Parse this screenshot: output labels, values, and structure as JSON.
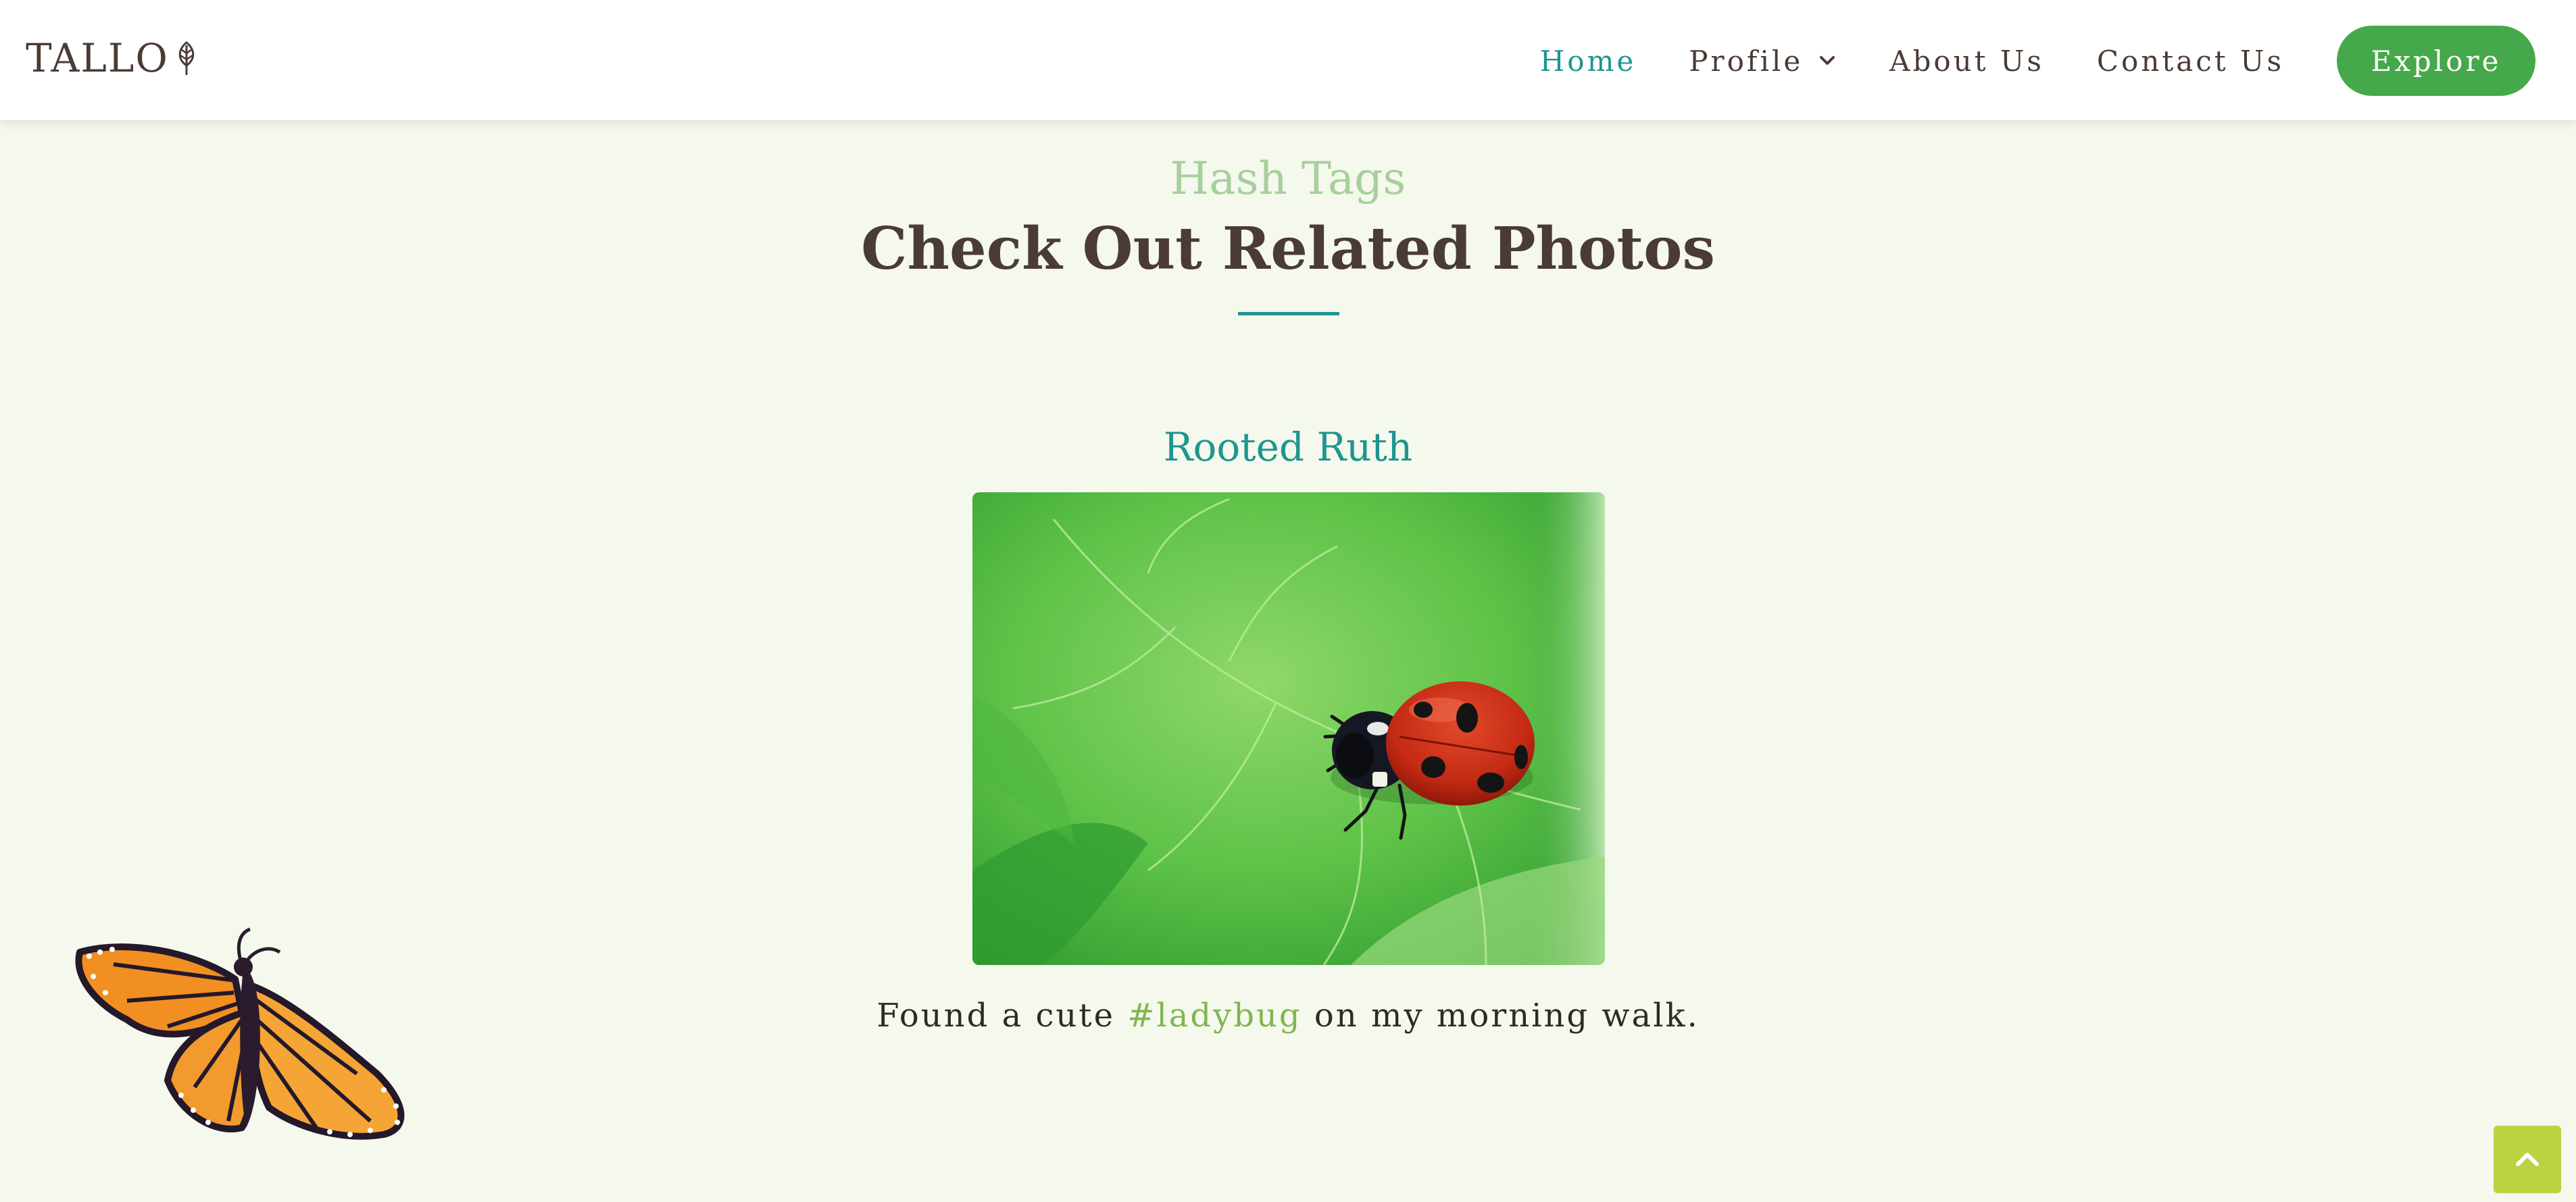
{
  "header": {
    "logo_text": "TALLO",
    "nav": {
      "home": "Home",
      "profile": "Profile",
      "about": "About Us",
      "contact": "Contact Us",
      "explore": "Explore"
    }
  },
  "section": {
    "eyebrow": "Hash Tags",
    "title": "Check Out Related Photos"
  },
  "post": {
    "author": "Rooted Ruth",
    "image_alt": "ladybug on a leaf",
    "caption_before": "Found a cute ",
    "hashtag": "#ladybug",
    "caption_after": " on my morning walk."
  },
  "icons": {
    "logo": "leaf-icon",
    "profile_dropdown": "chevron-down-icon",
    "back_to_top": "chevron-up-icon",
    "decoration": "butterfly-illustration"
  },
  "colors": {
    "background": "#f5f8ec",
    "accent_teal": "#1e9590",
    "button_green": "#45a84a",
    "hashtag_green": "#7fb650",
    "eyebrow_green": "#a7cf9c",
    "heading_brown": "#4a3b34",
    "to_top_lime": "#b9d341"
  }
}
